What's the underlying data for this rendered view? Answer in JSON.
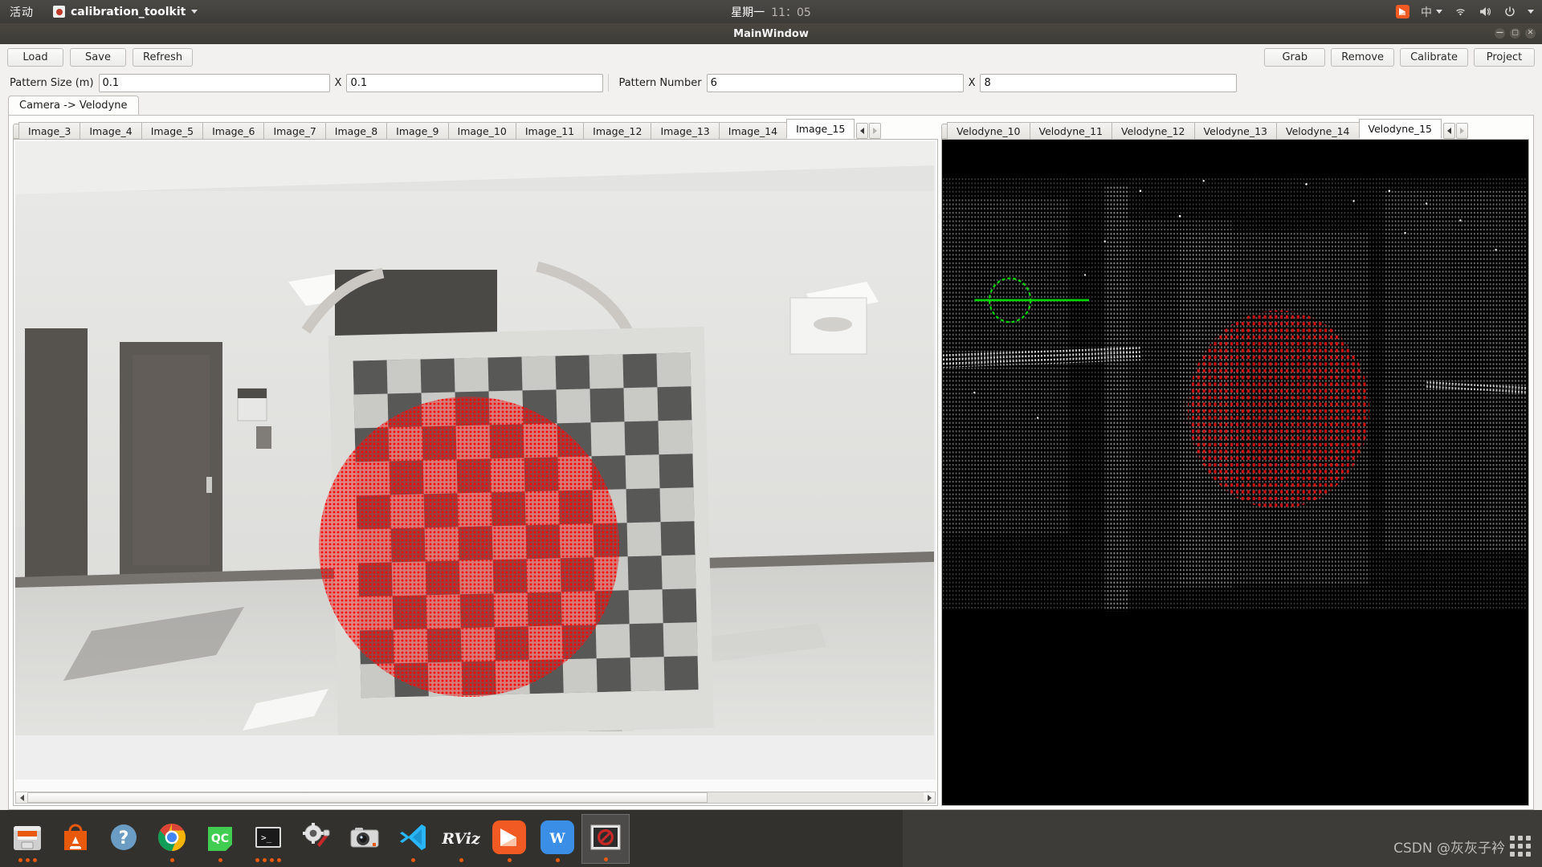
{
  "top_panel": {
    "activities": "活动",
    "app_name": "calibration_toolkit",
    "app_icon": "app-menu-icon",
    "clock": {
      "day_of_week": "星期一",
      "time": "11：05"
    },
    "tray": {
      "mail_icon": "foxmail-tray-icon",
      "ime_label": "中",
      "wifi_icon": "wifi-icon",
      "volume_icon": "volume-icon",
      "power_icon": "power-icon"
    }
  },
  "window": {
    "title": "MainWindow",
    "controls": {
      "minimize": "—",
      "maximize": "▢",
      "close": "✕"
    }
  },
  "toolbar": {
    "left_buttons": [
      "Load",
      "Save",
      "Refresh"
    ],
    "right_buttons": [
      "Grab",
      "Remove",
      "Calibrate",
      "Project"
    ]
  },
  "params": {
    "pattern_size_label": "Pattern Size (m)",
    "pattern_size_x": "0.1",
    "x_separator_1": "X",
    "pattern_size_y": "0.1",
    "pattern_number_label": "Pattern Number",
    "pattern_number_x": "6",
    "x_separator_2": "X",
    "pattern_number_y": "8"
  },
  "outer_tabs": [
    {
      "label": "Camera -> Velodyne",
      "active": true
    }
  ],
  "camera_pane": {
    "tabs": [
      {
        "label": "Image_3",
        "active": false
      },
      {
        "label": "Image_4",
        "active": false
      },
      {
        "label": "Image_5",
        "active": false
      },
      {
        "label": "Image_6",
        "active": false
      },
      {
        "label": "Image_7",
        "active": false
      },
      {
        "label": "Image_8",
        "active": false
      },
      {
        "label": "Image_9",
        "active": false
      },
      {
        "label": "Image_10",
        "active": false
      },
      {
        "label": "Image_11",
        "active": false
      },
      {
        "label": "Image_12",
        "active": false
      },
      {
        "label": "Image_13",
        "active": false
      },
      {
        "label": "Image_14",
        "active": false
      },
      {
        "label": "Image_15",
        "active": true
      }
    ],
    "nav_prev_icon": "tab-scroll-left-icon",
    "nav_next_icon": "tab-scroll-right-icon",
    "image_description": "Grayscale indoor corridor photo: a person holds a large checkerboard calibration target; a dense red circular overlay of detected projection points covers the board centre.",
    "overlay_color": "#ff0000",
    "scrollbar": {
      "left_arrow": "◀",
      "right_arrow": "▶",
      "thumb_percent": 74
    }
  },
  "lidar_pane": {
    "tabs": [
      {
        "label": "Velodyne_10",
        "active": false
      },
      {
        "label": "Velodyne_11",
        "active": false
      },
      {
        "label": "Velodyne_12",
        "active": false
      },
      {
        "label": "Velodyne_13",
        "active": false
      },
      {
        "label": "Velodyne_14",
        "active": false
      },
      {
        "label": "Velodyne_15",
        "active": true
      }
    ],
    "nav_prev_icon": "tab-scroll-left-icon",
    "nav_next_icon": "tab-scroll-right-icon",
    "cloud_description": "Black Velodyne point-cloud viewport: white/grey LiDAR returns outline a room, a red circular cluster marks the calibration board, and a green circle with a horizontal green axis line marks the sensor origin.",
    "point_color": "#d8d8d8",
    "marker_color": "#cc1111",
    "axis_color": "#00d400"
  },
  "launcher": {
    "items": [
      {
        "name": "files",
        "label": "Files",
        "dots": 3,
        "selected": false
      },
      {
        "name": "software",
        "label": "Ubuntu Software",
        "dots": 0,
        "selected": false
      },
      {
        "name": "help",
        "label": "Help",
        "dots": 0,
        "selected": false
      },
      {
        "name": "chrome",
        "label": "Google Chrome",
        "dots": 1,
        "selected": false
      },
      {
        "name": "qtcreator",
        "label": "Qt Creator",
        "dots": 1,
        "selected": false
      },
      {
        "name": "terminal",
        "label": "Terminal",
        "dots": 4,
        "selected": false
      },
      {
        "name": "settings",
        "label": "System Settings",
        "dots": 0,
        "selected": false
      },
      {
        "name": "camera",
        "label": "Camera",
        "dots": 0,
        "selected": false
      },
      {
        "name": "vscode",
        "label": "Visual Studio Code",
        "dots": 1,
        "selected": false
      },
      {
        "name": "rviz",
        "label": "RViz",
        "dots": 1,
        "selected": false
      },
      {
        "name": "foxmail",
        "label": "Foxmail",
        "dots": 1,
        "selected": false
      },
      {
        "name": "wps",
        "label": "WPS Writer",
        "dots": 1,
        "selected": false
      },
      {
        "name": "calibration",
        "label": "calibration_toolkit",
        "dots": 1,
        "selected": true
      }
    ]
  },
  "watermark": {
    "text": "CSDN @灰灰子衿"
  }
}
